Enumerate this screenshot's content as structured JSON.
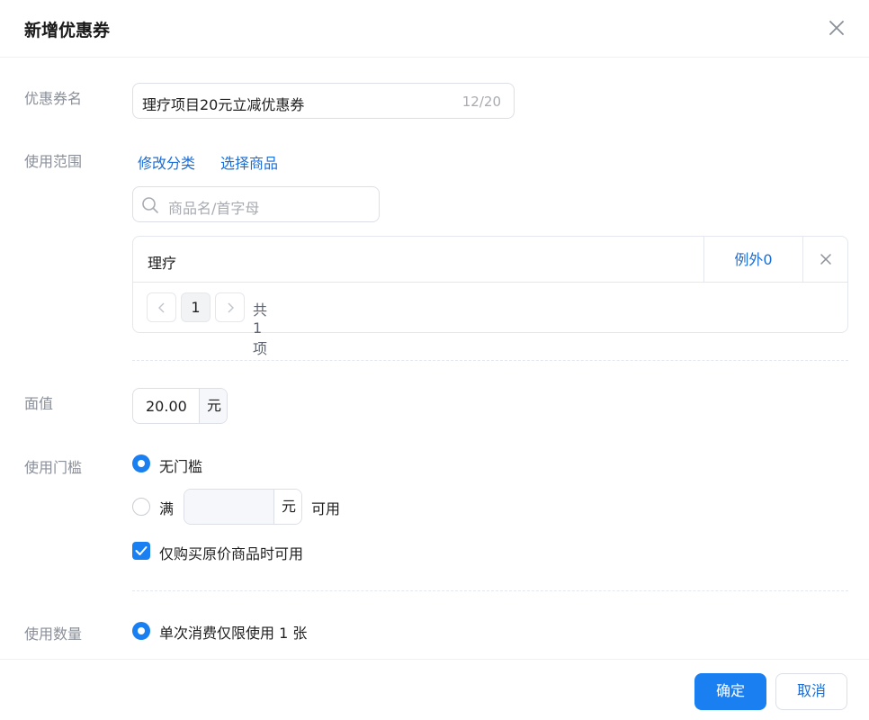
{
  "dialog": {
    "title": "新增优惠券",
    "close_icon": "close-icon"
  },
  "coupon_name": {
    "label": "优惠券名",
    "value": "理疗项目20元立减优惠券",
    "counter": "12/20"
  },
  "scope": {
    "label": "使用范围",
    "links": {
      "modify_category": "修改分类",
      "select_products": "选择商品"
    },
    "search": {
      "placeholder": "商品名/首字母",
      "icon": "search-icon"
    },
    "table": {
      "rows": [
        {
          "name": "理疗",
          "exception": "例外0",
          "delete_icon": "close-icon"
        }
      ],
      "pagination": {
        "current_page": "1",
        "total": "共 1 项"
      }
    }
  },
  "face_value": {
    "label": "面值",
    "value": "20.00",
    "unit": "元"
  },
  "threshold": {
    "label": "使用门槛",
    "options": {
      "none": "无门槛",
      "full_prefix": "满",
      "full_unit": "元",
      "full_suffix": "可用"
    },
    "selected": "none",
    "min_value": "",
    "original_price_only": {
      "label": "仅购买原价商品时可用",
      "checked": true
    }
  },
  "quantity": {
    "label": "使用数量",
    "option": "单次消费仅限使用 1 张",
    "selected": true
  },
  "footer": {
    "confirm": "确定",
    "cancel": "取消"
  },
  "colors": {
    "primary": "#1a7ff0",
    "link": "#1a6ed8",
    "label": "#8a8f99",
    "border": "#dcdfe6"
  }
}
